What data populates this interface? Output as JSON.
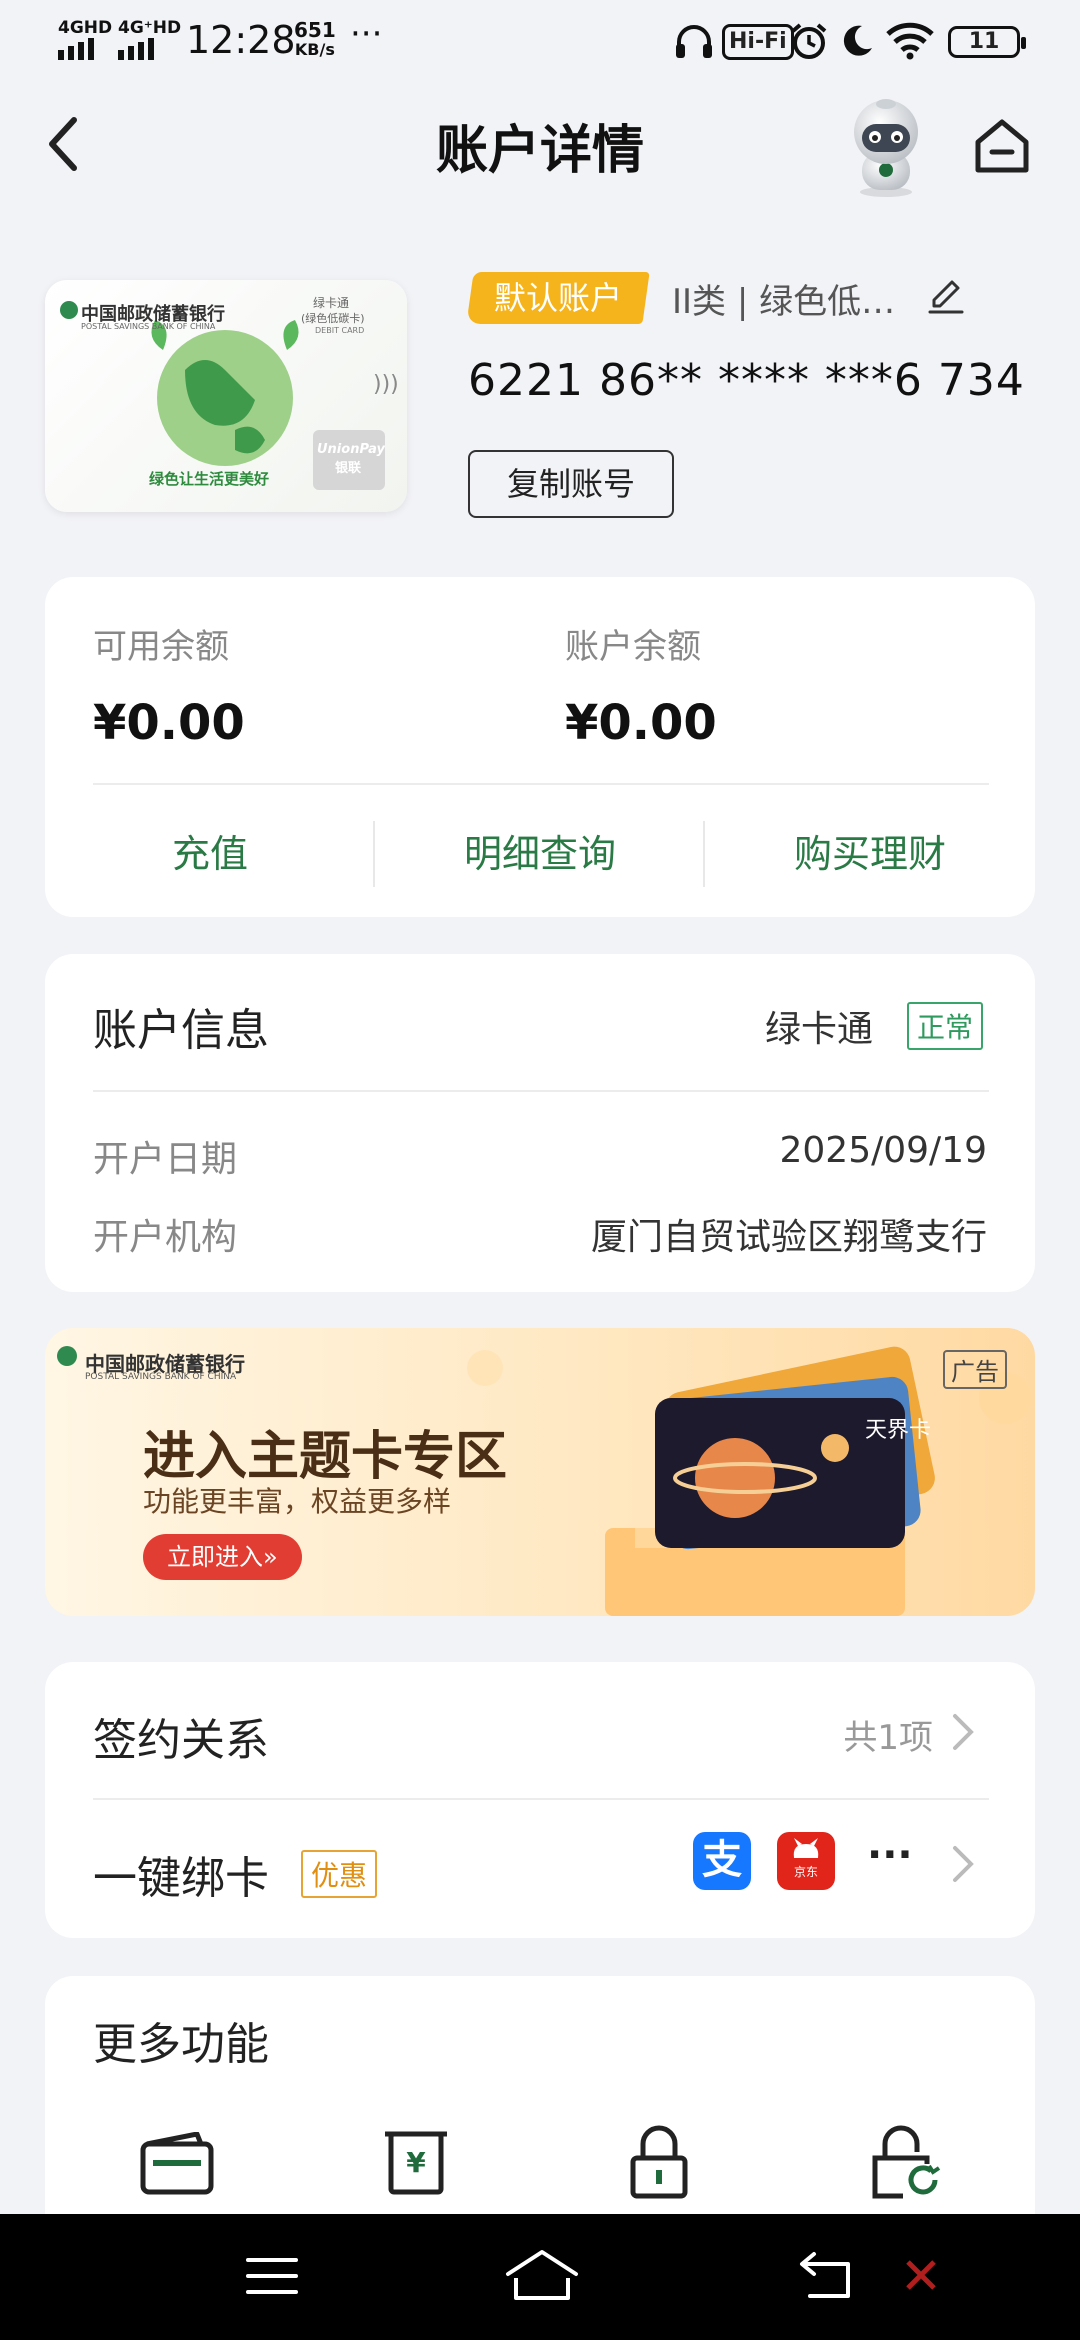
{
  "status_bar": {
    "network1": "4GHD",
    "network2": "4G⁺HD",
    "time": "12:28",
    "speed_value": "651",
    "speed_unit": "KB/s",
    "more": "···",
    "hifi": "Hi-Fi",
    "battery": "11"
  },
  "header": {
    "title": "账户详情"
  },
  "account": {
    "default_tag": "默认账户",
    "type": "II类 | 绿色低…",
    "number": "6221 86** **** ***6 734",
    "copy_label": "复制账号",
    "card_bank_cn": "中国邮政储蓄银行",
    "card_bank_en": "POSTAL SAVINGS BANK OF CHINA",
    "card_product": "绿卡通",
    "card_product_sub": "(绿色低碳卡)",
    "card_debit": "DEBIT CARD",
    "card_slogan": "绿色让生活更美好",
    "card_unionpay": "UnionPay",
    "card_unionpay_cn": "银联"
  },
  "balance": {
    "available_label": "可用余额",
    "available_value": "¥0.00",
    "account_label": "账户余额",
    "account_value": "¥0.00",
    "actions": [
      "充值",
      "明细查询",
      "购买理财"
    ]
  },
  "account_info": {
    "title": "账户信息",
    "product": "绿卡通",
    "status": "正常",
    "open_date_label": "开户日期",
    "open_date_value": "2025/09/19",
    "branch_label": "开户机构",
    "branch_value": "厦门自贸试验区翔鹭支行"
  },
  "banner": {
    "bank_cn": "中国邮政储蓄银行",
    "bank_en": "POSTAL SAVINGS BANK OF CHINA",
    "ad_tag": "广告",
    "headline": "进入主题卡专区",
    "subline": "功能更丰富，权益更多样",
    "cta": "立即进入»",
    "card_name": "天界卡"
  },
  "signing": {
    "title": "签约关系",
    "count": "共1项",
    "bind_title": "一键绑卡",
    "bind_badge": "优惠",
    "jd_label": "京东",
    "more_dots": "···"
  },
  "more_functions": {
    "title": "更多功能"
  },
  "colors": {
    "accent_green": "#2a7a45",
    "tag_yellow": "#f6b41c",
    "alipay_blue": "#1677ff",
    "jd_red": "#e1251b"
  }
}
